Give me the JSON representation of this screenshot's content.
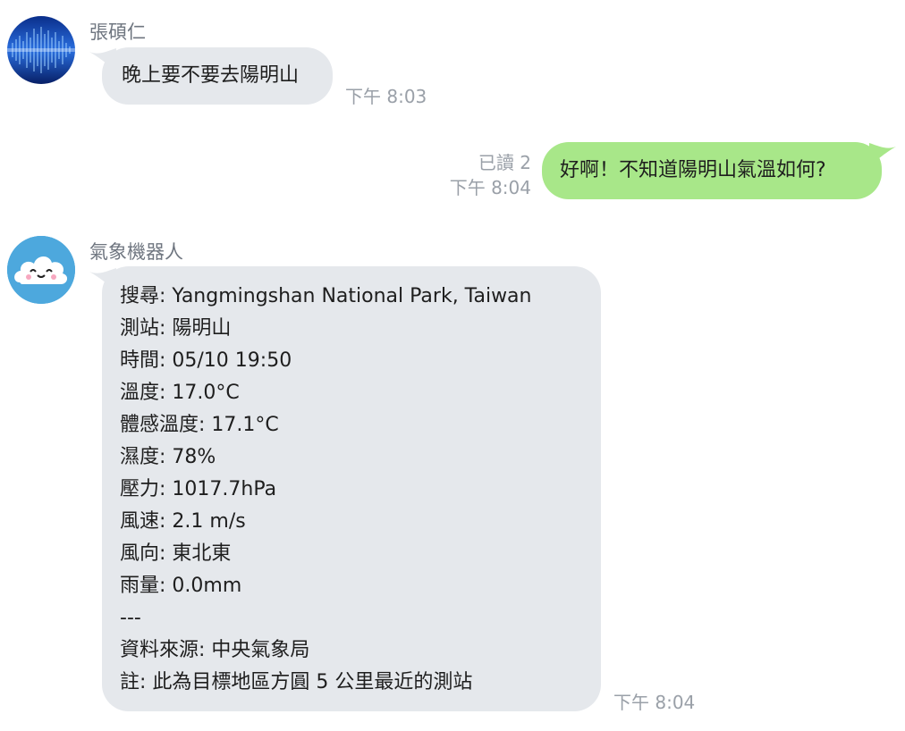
{
  "messages": [
    {
      "sender": "張碩仁",
      "text": "晚上要不要去陽明山",
      "time": "下午 8:03"
    },
    {
      "read_receipt": "已讀 2",
      "text": "好啊！不知道陽明山氣溫如何?",
      "time": "下午 8:04"
    },
    {
      "sender": "氣象機器人",
      "lines": [
        "搜尋:  Yangmingshan National Park, Taiwan",
        "測站: 陽明山",
        "時間: 05/10 19:50",
        "溫度: 17.0°C",
        "體感溫度: 17.1°C",
        "濕度: 78%",
        "壓力: 1017.7hPa",
        "風速: 2.1 m/s",
        "風向: 東北東",
        "雨量: 0.0mm",
        "---",
        "資料來源: 中央氣象局",
        "註: 此為目標地區方圓 5 公里最近的測站"
      ],
      "time": "下午 8:04"
    }
  ],
  "colors": {
    "incoming_bubble": "#e5e8ec",
    "outgoing_bubble": "#a8e789",
    "meta_text": "#9aa0a8",
    "sender_text": "#6f7680",
    "bot_avatar_bg": "#4da8dd"
  },
  "icons": {
    "user_avatar": "blue-soundwave-avatar",
    "bot_avatar": "cloud-face-avatar"
  }
}
